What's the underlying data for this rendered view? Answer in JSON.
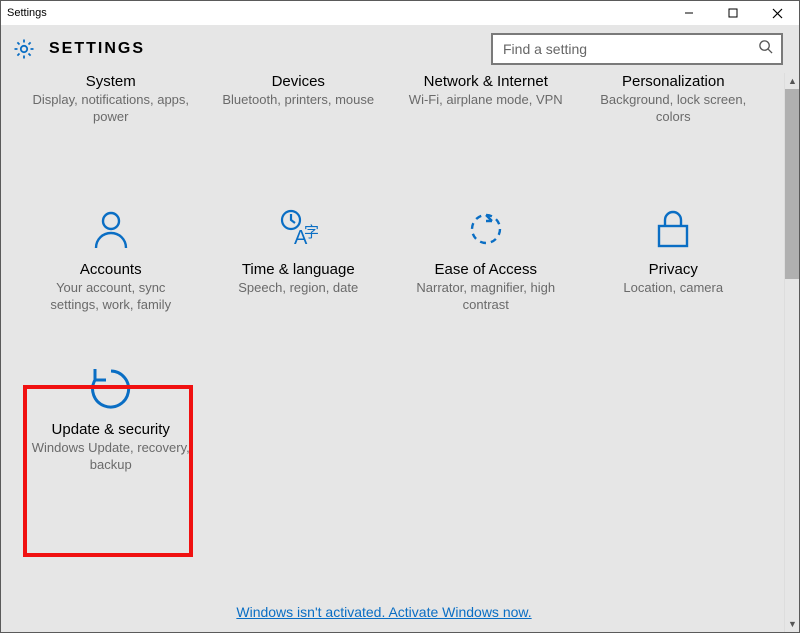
{
  "window": {
    "title": "Settings"
  },
  "header": {
    "page_title": "SETTINGS",
    "search_placeholder": "Find a setting"
  },
  "categories": [
    {
      "title": "System",
      "sub": "Display, notifications, apps, power"
    },
    {
      "title": "Devices",
      "sub": "Bluetooth, printers, mouse"
    },
    {
      "title": "Network & Internet",
      "sub": "Wi-Fi, airplane mode, VPN"
    },
    {
      "title": "Personalization",
      "sub": "Background, lock screen, colors"
    },
    {
      "title": "Accounts",
      "sub": "Your account, sync settings, work, family"
    },
    {
      "title": "Time & language",
      "sub": "Speech, region, date"
    },
    {
      "title": "Ease of Access",
      "sub": "Narrator, magnifier, high contrast"
    },
    {
      "title": "Privacy",
      "sub": "Location, camera"
    },
    {
      "title": "Update & security",
      "sub": "Windows Update, recovery, backup"
    }
  ],
  "footer": {
    "activation_text": "Windows isn't activated. Activate Windows now."
  },
  "highlighted_index": 8
}
